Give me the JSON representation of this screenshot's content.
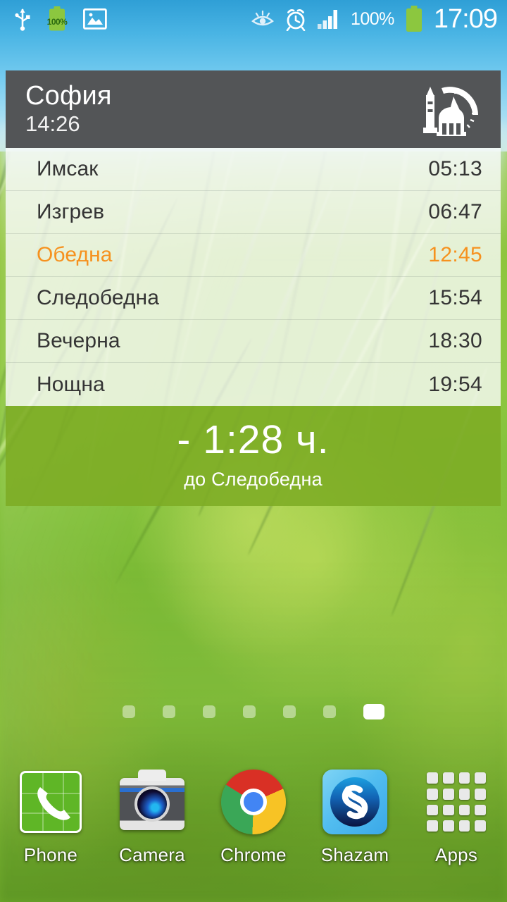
{
  "status_bar": {
    "left_icons": [
      "usb-icon",
      "battery-charging-icon",
      "screenshot-image-icon"
    ],
    "battery_badge": "100%",
    "right_icons": [
      "smart-stay-eye-icon",
      "alarm-clock-icon",
      "signal-bars-icon"
    ],
    "battery_percent": "100%",
    "clock": "17:09"
  },
  "widget": {
    "logo_icon": "mosque-compass-icon",
    "city": "София",
    "city_time": "14:26",
    "rows": [
      {
        "name": "Имсак",
        "time": "05:13",
        "active": false
      },
      {
        "name": "Изгрев",
        "time": "06:47",
        "active": false
      },
      {
        "name": "Обедна",
        "time": "12:45",
        "active": true
      },
      {
        "name": "Следобедна",
        "time": "15:54",
        "active": false
      },
      {
        "name": "Вечерна",
        "time": "18:30",
        "active": false
      },
      {
        "name": "Нощна",
        "time": "19:54",
        "active": false
      }
    ],
    "countdown": "- 1:28 ч.",
    "countdown_sub": "до Следобедна",
    "colors": {
      "header_bg": "#535557",
      "active_orange": "#f6911e",
      "countdown_green": "#7dac24",
      "list_bg": "#fafbfa"
    }
  },
  "page_indicator": {
    "count": 7,
    "active_index": 6
  },
  "dock": {
    "items": [
      {
        "label": "Phone",
        "icon": "phone-dialer-icon"
      },
      {
        "label": "Camera",
        "icon": "camera-icon"
      },
      {
        "label": "Chrome",
        "icon": "chrome-browser-icon"
      },
      {
        "label": "Shazam",
        "icon": "shazam-icon"
      },
      {
        "label": "Apps",
        "icon": "apps-grid-icon"
      }
    ]
  }
}
